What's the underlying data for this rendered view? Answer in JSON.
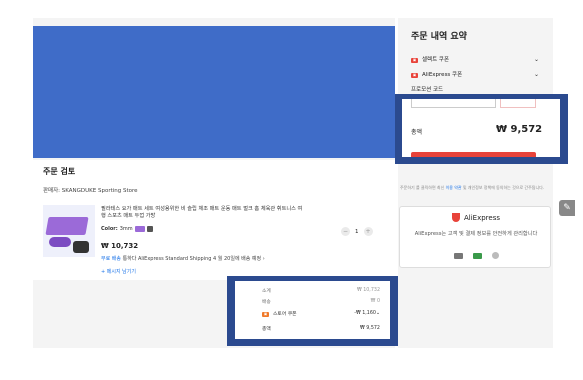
{
  "order_summary": {
    "title": "주문 내역 요약",
    "coupons": [
      {
        "icon": "coupon-tag-icon",
        "label": "셀렉트 쿠폰"
      },
      {
        "icon": "coupon-tag-icon",
        "label": "AliExpress 쿠폰"
      }
    ],
    "promo_label": "프로모션 코드",
    "promo_input_value": "",
    "apply_label": "",
    "total_label": "총액",
    "total_value": "₩ 9,572",
    "legal_text_prefix": "주문하기 를 클릭하면 최신 ",
    "legal_link": "이용 약관",
    "legal_text_suffix": " 및 개인정보 정책에 동의하는 것으로 간주됩니다."
  },
  "secure": {
    "brand": "AliExpress",
    "text": "AliExpress는 고객 및 결제 정보를 안전하게 관리합니다",
    "icons": [
      "card-icon",
      "bank-icon",
      "wallet-icon"
    ]
  },
  "review": {
    "title": "주문 검토",
    "seller": "판매자: SKANGDUKE Sporting Store",
    "product": {
      "title": "필라테스 요가 매트 세트 여성용위한 비 슬립 체조 매트 운동 매트 벌크 홈 체육관 휘트니스 여행 스포츠 매트 두껍 가방",
      "color_label": "Color:",
      "color_value": "3mm",
      "quantity": "1",
      "price": "₩ 10,732",
      "shipping_free": "무료 배송",
      "shipping_text": " 통하다 AliExpress Standard Shipping 4 월 20일에 배송 예정",
      "note_link": "+ 메시지 남기기"
    }
  },
  "summary": {
    "rows": [
      {
        "label": "소계",
        "value": "₩ 10,732"
      },
      {
        "label": "배송",
        "value": "₩ 0"
      },
      {
        "label": "스토어 쿠폰",
        "value": "-₩ 1,160"
      },
      {
        "label": "총액",
        "value": "₩ 9,572"
      }
    ]
  },
  "colors": {
    "accent": "#e8433a",
    "link": "#1a73e8",
    "overlay_blue": "#2b4a8f",
    "image_blue": "#3f6cc8"
  }
}
